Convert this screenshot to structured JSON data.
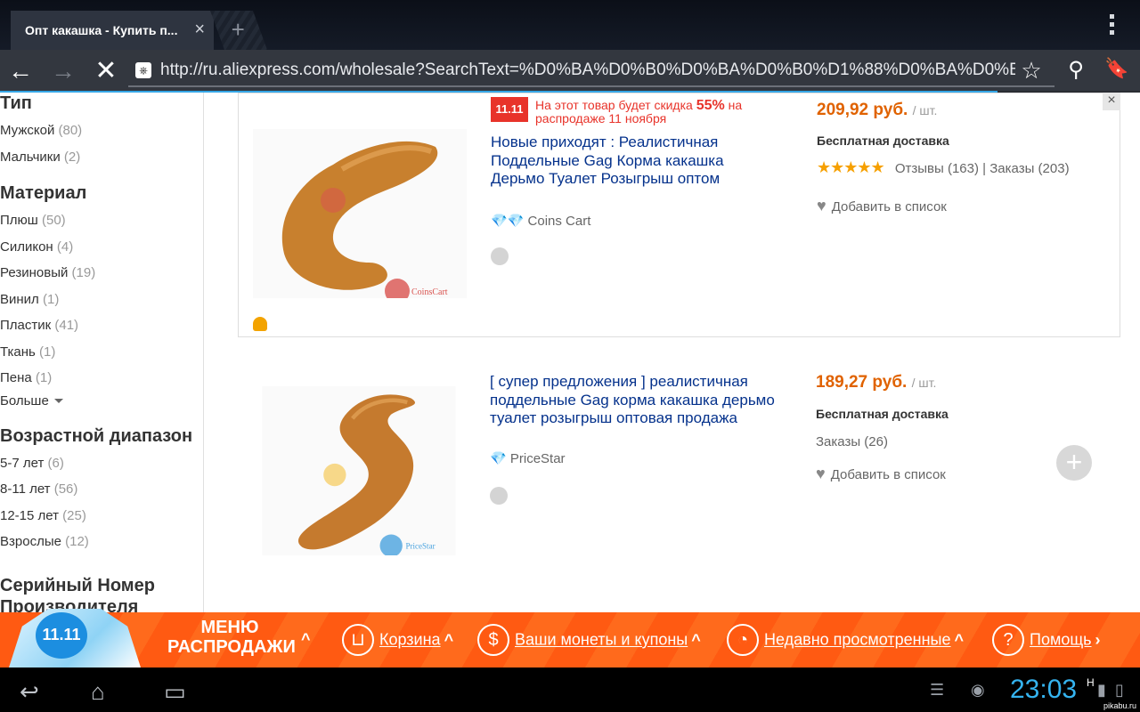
{
  "browser": {
    "tab_title": "Опт какашка - Купить п...",
    "tab_close": "×",
    "new_tab": "+",
    "url": "http://ru.aliexpress.com/wholesale?SearchText=%D0%BA%D0%B0%D0%BA%D0%B0%D1%88%D0%BA%D0%B0&enSearcl",
    "site_icon": "⎈"
  },
  "filters": [
    {
      "title": "Тип",
      "items": [
        {
          "label": "Мужской",
          "count": "(80)"
        },
        {
          "label": "Мальчики",
          "count": "(2)"
        }
      ]
    },
    {
      "title": "Материал",
      "items": [
        {
          "label": "Плюш",
          "count": "(50)"
        },
        {
          "label": "Силикон",
          "count": "(4)"
        },
        {
          "label": "Резиновый",
          "count": "(19)"
        },
        {
          "label": "Винил",
          "count": "(1)"
        },
        {
          "label": "Пластик",
          "count": "(41)"
        },
        {
          "label": "Ткань",
          "count": "(1)"
        },
        {
          "label": "Пена",
          "count": "(1)"
        }
      ],
      "more": "Больше"
    },
    {
      "title": "Возрастной диапазон",
      "items": [
        {
          "label": "5-7 лет",
          "count": "(6)"
        },
        {
          "label": "8-11 лет",
          "count": "(56)"
        },
        {
          "label": "12-15 лет",
          "count": "(25)"
        },
        {
          "label": "Взрослые",
          "count": "(12)"
        }
      ]
    },
    {
      "title": "Серийный Номер Производителя",
      "items": []
    }
  ],
  "products": [
    {
      "sale_logo": "11.11",
      "sale_text_pre": "На этот товар будет скидка",
      "sale_pct": "55%",
      "sale_text_post": "на распродаже 11 ноября",
      "title": "Новые приходят : Реалистичная Поддельные Gag Корма какашка Дерьмо Туалет Розыгрыш оптом",
      "price": "209,92 руб.",
      "unit": "/ шт.",
      "shipping": "Бесплатная доставка",
      "stars": "★★★★★",
      "reviews": "Отзывы (163)",
      "separator": "|",
      "orders": "Заказы (203)",
      "wishlist": "Добавить в список",
      "seller": "Coins Cart",
      "seller_diamonds": "💎💎",
      "watermark": "CoinsCart",
      "close": "×"
    },
    {
      "title": "[ супер предложения ] реалистичная поддельные Gag корма какашка дерьмо туалет розыгрыш оптовая продажа",
      "price": "189,27 руб.",
      "unit": "/ шт.",
      "shipping": "Бесплатная доставка",
      "orders": "Заказы (26)",
      "wishlist": "Добавить в список",
      "seller": "PriceStar",
      "seller_diamonds": "💎",
      "watermark": "PriceStar",
      "add": "+"
    }
  ],
  "promo_bar": {
    "logo": "11.11",
    "menu": "МЕНЮ РАСПРОДАЖИ",
    "items": [
      {
        "label": "Корзина",
        "icon": "cart-icon"
      },
      {
        "label": "Ваши монеты и купоны",
        "icon": "dollar-icon"
      },
      {
        "label": "Недавно просмотренные",
        "icon": "clock-icon"
      },
      {
        "label": "Помощь",
        "icon": "question-icon"
      }
    ]
  },
  "system": {
    "time": "23:03",
    "network": "H",
    "watermark": "pikabu.ru"
  },
  "colors": {
    "accent_orange": "#ff5a12",
    "price": "#e06200",
    "link": "#05328c",
    "sale_red": "#e8332a",
    "clock": "#35b4f0"
  }
}
